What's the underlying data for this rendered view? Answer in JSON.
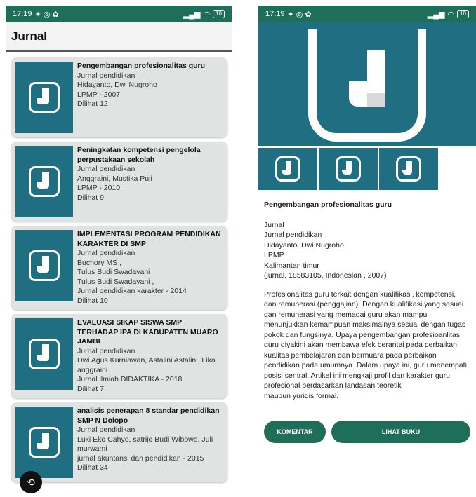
{
  "status_bar": {
    "time": "17:19",
    "battery": "10"
  },
  "left": {
    "title": "Jurnal",
    "cards": [
      {
        "title": "Pengembangan profesionalitas guru",
        "lines": [
          "Jurnal pendidikan",
          "Hidayanto, Dwi Nugroho",
          "LPMP - 2007",
          "Dilihat 12"
        ]
      },
      {
        "title": "Peningkatan kompetensi pengelola perpustakaan sekolah",
        "lines": [
          "Jurnal pendidikan",
          "Anggraini, Mustika Puji",
          "LPMP - 2010",
          "Dilihat 9"
        ]
      },
      {
        "title": "IMPLEMENTASI PROGRAM PENDIDIKAN KARAKTER DI SMP",
        "lines": [
          "Jurnal pendidikan",
          "Buchory MS ,",
          "Tulus Budi Swadayani",
          "Tulus Budi Swadayani ,",
          "Jurnal pendidikan karakter  - 2014",
          "Dilihat 10"
        ]
      },
      {
        "title": "EVALUASI SIKAP SISWA SMP TERHADAP IPA DI KABUPATEN MUARO JAMBI",
        "lines": [
          "Jurnal pendidikan",
          "Dwi Agus Kurniawan, Astalini Astalini, Lika anggraini",
          "Jurnal ilmiah DIDAKTIKA - 2018",
          "Dilihat 7"
        ]
      },
      {
        "title": "analisis penerapan 8 standar pendidikan SMP N Dolopo",
        "lines": [
          "Jurnal pendidikan",
          "Luki Eko Cahyo, satrijo Budi Wibowo, Juli murwami",
          "jurnal akuntansi dan pendidikan  - 2015",
          "Dilihat 34"
        ]
      }
    ]
  },
  "right": {
    "title": "Pengembangan profesionalitas guru",
    "info": [
      "Jurnal",
      "Jurnal pendidikan",
      "Hidayanto, Dwi Nugroho",
      "LPMP",
      "Kalimantan timur",
      "(jurnal, 18583105, Indonesian , 2007)"
    ],
    "abstract_lines": [
      "Profesionalitas guru terkait dengan kualifikasi, kompetensi,",
      "dan remunerasi (penggajian). Dengan kualifikasi yang sesuai",
      "dan remunerasi yang memadai guru akan mampu",
      "menunjukkan kemampuan maksimalnya sesuai dengan tugas",
      "pokok dan fungsinya. Upaya pengembangan profesioanlitas",
      "guru diyakini akan membawa efek berantai pada perbaikan",
      "kualitas pembelajaran dan bermuara pada perbaikan",
      "pendidikan pada umumnya. Dalam upaya ini, guru menempati",
      "posisi sentral. Artikel ini mengkaji profil dan karakter guru",
      "profesional berdasarkan landasan teoretik",
      "maupun yuridis formal."
    ],
    "buttons": {
      "comment": "KOMENTAR",
      "book": "LIHAT BUKU"
    }
  },
  "colors": {
    "statusbar": "#1f6e59",
    "thumb": "#1f6e82",
    "button": "#1f6e59",
    "card": "#dfe3e1"
  },
  "icons": [
    "wifi-icon",
    "signal-icon",
    "battery-icon",
    "rotate-icon",
    "journal-logo-icon"
  ]
}
